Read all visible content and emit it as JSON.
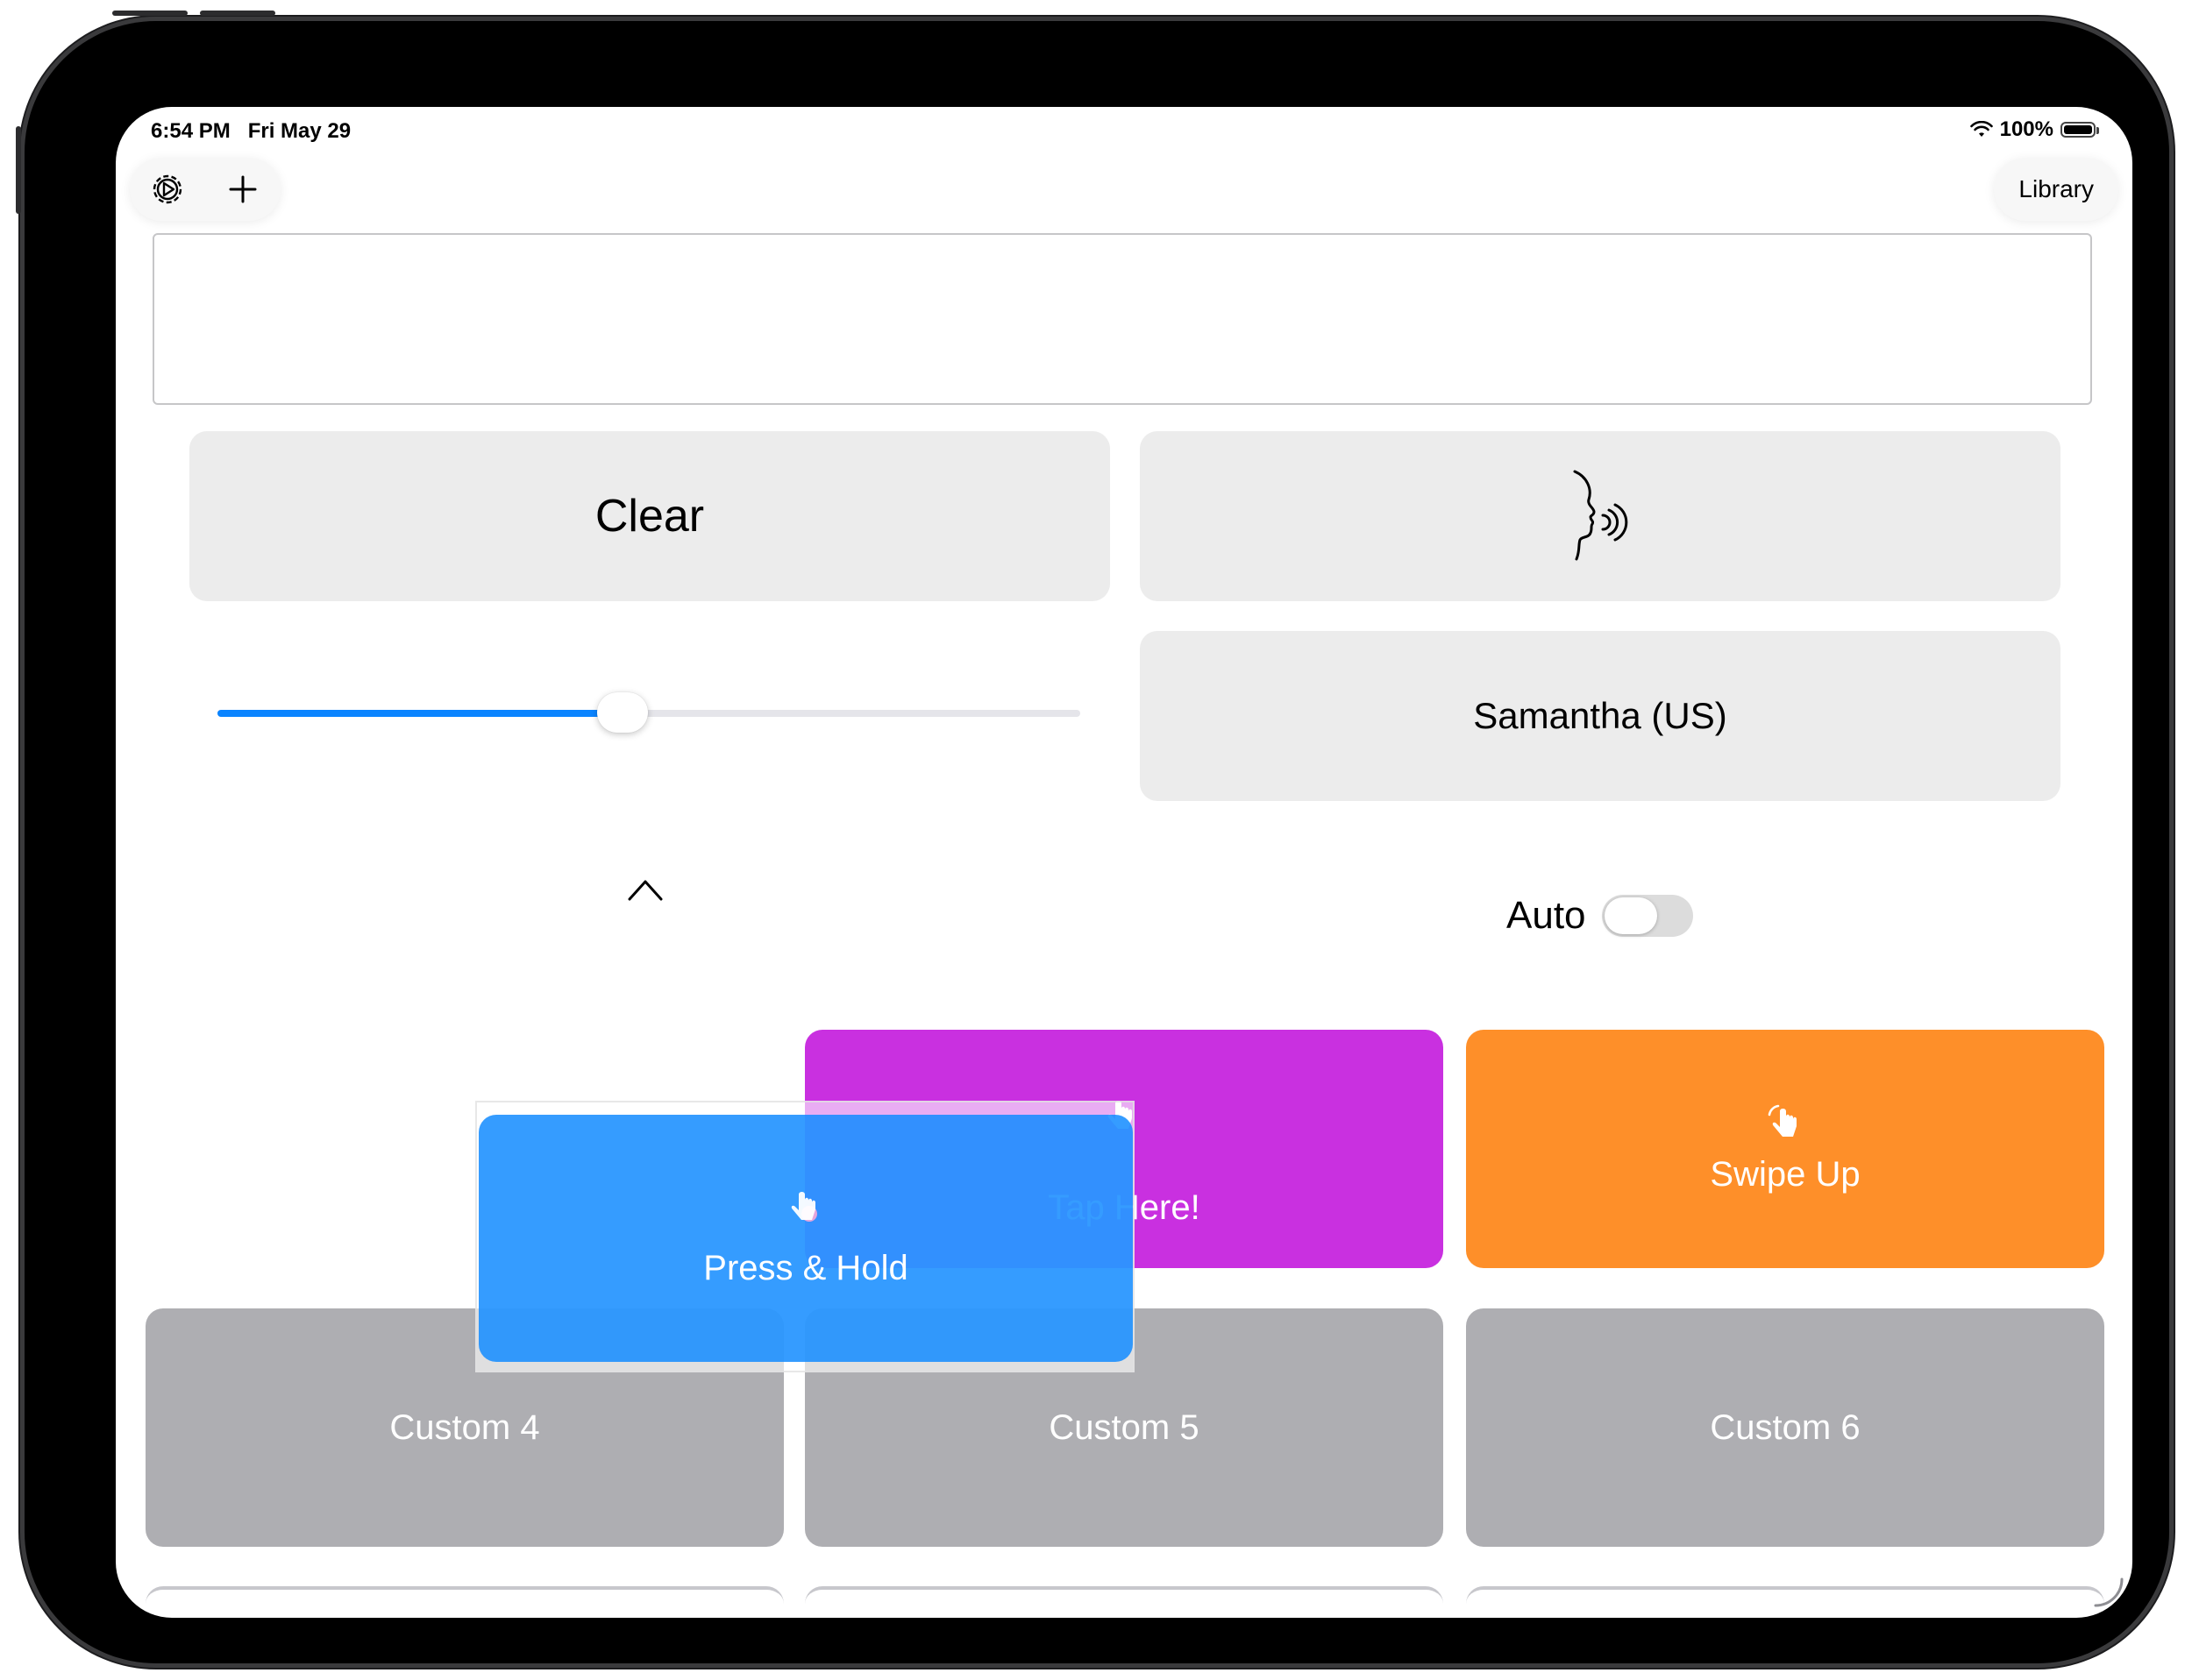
{
  "status_bar": {
    "time": "6:54 PM",
    "date": "Fri May 29",
    "battery_text": "100%"
  },
  "toolbar": {
    "settings_icon": "gear-icon",
    "add_icon": "plus-icon",
    "library_label": "Library"
  },
  "text_field": {
    "value": ""
  },
  "controls": {
    "clear_label": "Clear",
    "speak_icon": "speaking-head-icon",
    "voice_label": "Samantha (US)",
    "rate_slider_value": 0.47,
    "collapse_icon": "chevron-up-icon",
    "auto_label": "Auto",
    "auto_on": false
  },
  "tiles": {
    "tap_here": {
      "label": "Tap Here!",
      "color": "#C930E0",
      "icon": "tap-hand-icon"
    },
    "swipe_up": {
      "label": "Swipe Up",
      "color": "#FE8F29",
      "icon": "swipe-hand-icon"
    },
    "press_hold": {
      "label": "Press & Hold",
      "color": "#148CFF",
      "icon": "press-hand-icon"
    },
    "custom4": {
      "label": "Custom 4",
      "color": "#AEAEB2"
    },
    "custom5": {
      "label": "Custom 5",
      "color": "#AEAEB2"
    },
    "custom6": {
      "label": "Custom 6",
      "color": "#AEAEB2"
    }
  }
}
